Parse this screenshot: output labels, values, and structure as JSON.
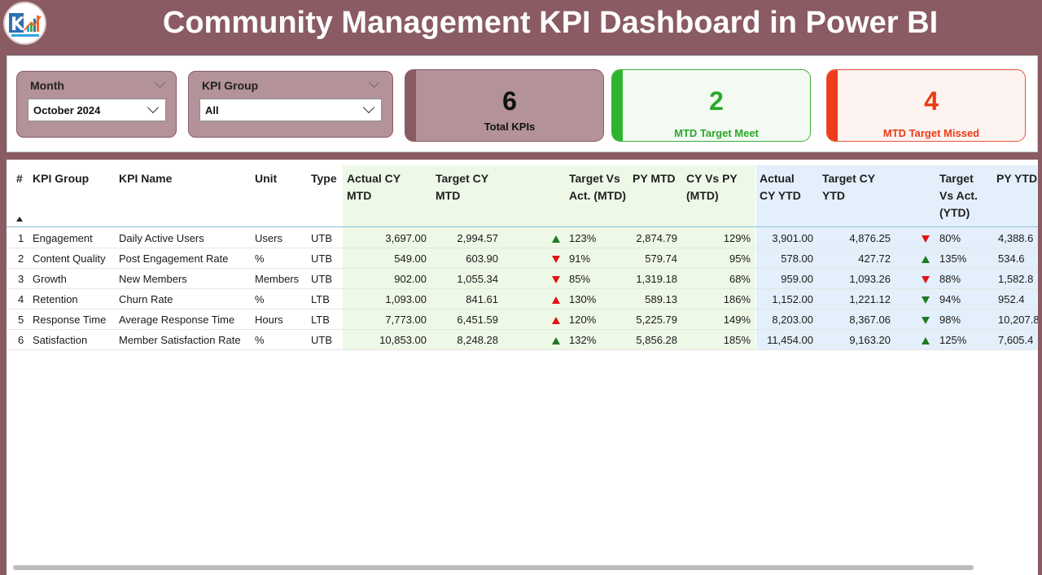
{
  "header": {
    "title": "Community Management KPI Dashboard in Power BI",
    "logo_icon": "logo-icon"
  },
  "filters": {
    "month": {
      "label": "Month",
      "value": "October 2024"
    },
    "kpi_group": {
      "label": "KPI Group",
      "value": "All"
    }
  },
  "cards": {
    "total": {
      "value": "6",
      "label": "Total KPIs"
    },
    "meet": {
      "value": "2",
      "label": "MTD Target Meet"
    },
    "missed": {
      "value": "4",
      "label": "MTD Target Missed"
    }
  },
  "colors": {
    "brand": "#8a5b63",
    "slicer_bg": "#b3929a",
    "meet": "#2aa82a",
    "missed": "#ea3a12",
    "mtd_band": "#eef8e6",
    "ytd_band": "#e3effa"
  },
  "table": {
    "columns": [
      "#",
      "KPI Group",
      "KPI Name",
      "Unit",
      "Type",
      "Actual CY MTD",
      "Target CY MTD",
      "",
      "Target Vs Act. (MTD)",
      "PY MTD",
      "CY Vs PY (MTD)",
      "Actual CY YTD",
      "Target CY YTD",
      "",
      "Target Vs Act. (YTD)",
      "PY YTD"
    ],
    "rows": [
      {
        "no": "1",
        "group": "Engagement",
        "name": "Daily Active Users",
        "unit": "Users",
        "type": "UTB",
        "act_mtd": "3,697.00",
        "tgt_mtd": "2,994.57",
        "mtd_icon": "up-green",
        "tva_mtd": "123%",
        "py_mtd": "2,874.79",
        "cvp_mtd": "129%",
        "act_ytd": "3,901.00",
        "tgt_ytd": "4,876.25",
        "ytd_icon": "down-red",
        "tva_ytd": "80%",
        "py_ytd": "4,388.6"
      },
      {
        "no": "2",
        "group": "Content Quality",
        "name": "Post Engagement Rate",
        "unit": "%",
        "type": "UTB",
        "act_mtd": "549.00",
        "tgt_mtd": "603.90",
        "mtd_icon": "down-red",
        "tva_mtd": "91%",
        "py_mtd": "579.74",
        "cvp_mtd": "95%",
        "act_ytd": "578.00",
        "tgt_ytd": "427.72",
        "ytd_icon": "up-green",
        "tva_ytd": "135%",
        "py_ytd": "534.6"
      },
      {
        "no": "3",
        "group": "Growth",
        "name": "New Members",
        "unit": "Members",
        "type": "UTB",
        "act_mtd": "902.00",
        "tgt_mtd": "1,055.34",
        "mtd_icon": "down-red",
        "tva_mtd": "85%",
        "py_mtd": "1,319.18",
        "cvp_mtd": "68%",
        "act_ytd": "959.00",
        "tgt_ytd": "1,093.26",
        "ytd_icon": "down-red",
        "tva_ytd": "88%",
        "py_ytd": "1,582.8"
      },
      {
        "no": "4",
        "group": "Retention",
        "name": "Churn Rate",
        "unit": "%",
        "type": "LTB",
        "act_mtd": "1,093.00",
        "tgt_mtd": "841.61",
        "mtd_icon": "up-red",
        "tva_mtd": "130%",
        "py_mtd": "589.13",
        "cvp_mtd": "186%",
        "act_ytd": "1,152.00",
        "tgt_ytd": "1,221.12",
        "ytd_icon": "down-green",
        "tva_ytd": "94%",
        "py_ytd": "952.4"
      },
      {
        "no": "5",
        "group": "Response Time",
        "name": "Average Response Time",
        "unit": "Hours",
        "type": "LTB",
        "act_mtd": "7,773.00",
        "tgt_mtd": "6,451.59",
        "mtd_icon": "up-red",
        "tva_mtd": "120%",
        "py_mtd": "5,225.79",
        "cvp_mtd": "149%",
        "act_ytd": "8,203.00",
        "tgt_ytd": "8,367.06",
        "ytd_icon": "down-green",
        "tva_ytd": "98%",
        "py_ytd": "10,207.8"
      },
      {
        "no": "6",
        "group": "Satisfaction",
        "name": "Member Satisfaction Rate",
        "unit": "%",
        "type": "UTB",
        "act_mtd": "10,853.00",
        "tgt_mtd": "8,248.28",
        "mtd_icon": "up-green",
        "tva_mtd": "132%",
        "py_mtd": "5,856.28",
        "cvp_mtd": "185%",
        "act_ytd": "11,454.00",
        "tgt_ytd": "9,163.20",
        "ytd_icon": "up-green",
        "tva_ytd": "125%",
        "py_ytd": "7,605.4"
      }
    ]
  }
}
